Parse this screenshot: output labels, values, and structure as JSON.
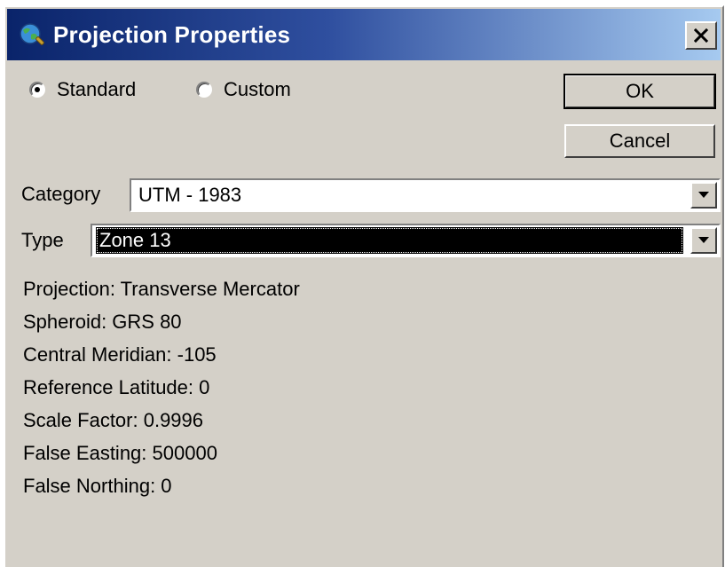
{
  "window": {
    "title": "Projection Properties"
  },
  "projection_mode": {
    "standard_label": "Standard",
    "custom_label": "Custom",
    "selected": "Standard"
  },
  "buttons": {
    "ok_label": "OK",
    "cancel_label": "Cancel"
  },
  "category": {
    "label": "Category",
    "value": "UTM - 1983"
  },
  "type": {
    "label": "Type",
    "value": "Zone 13"
  },
  "properties": [
    "Projection: Transverse Mercator",
    "Spheroid: GRS 80",
    "Central Meridian: -105",
    "Reference Latitude: 0",
    "Scale Factor: 0.9996",
    "False Easting: 500000",
    "False Northing: 0"
  ],
  "icons": {
    "app": "globe-icon",
    "close": "close-icon",
    "dropdown": "chevron-down-icon"
  },
  "colors": {
    "titlebar_start": "#0a246a",
    "titlebar_end": "#a6caf0",
    "face": "#d4d0c8",
    "selection": "#000000"
  }
}
